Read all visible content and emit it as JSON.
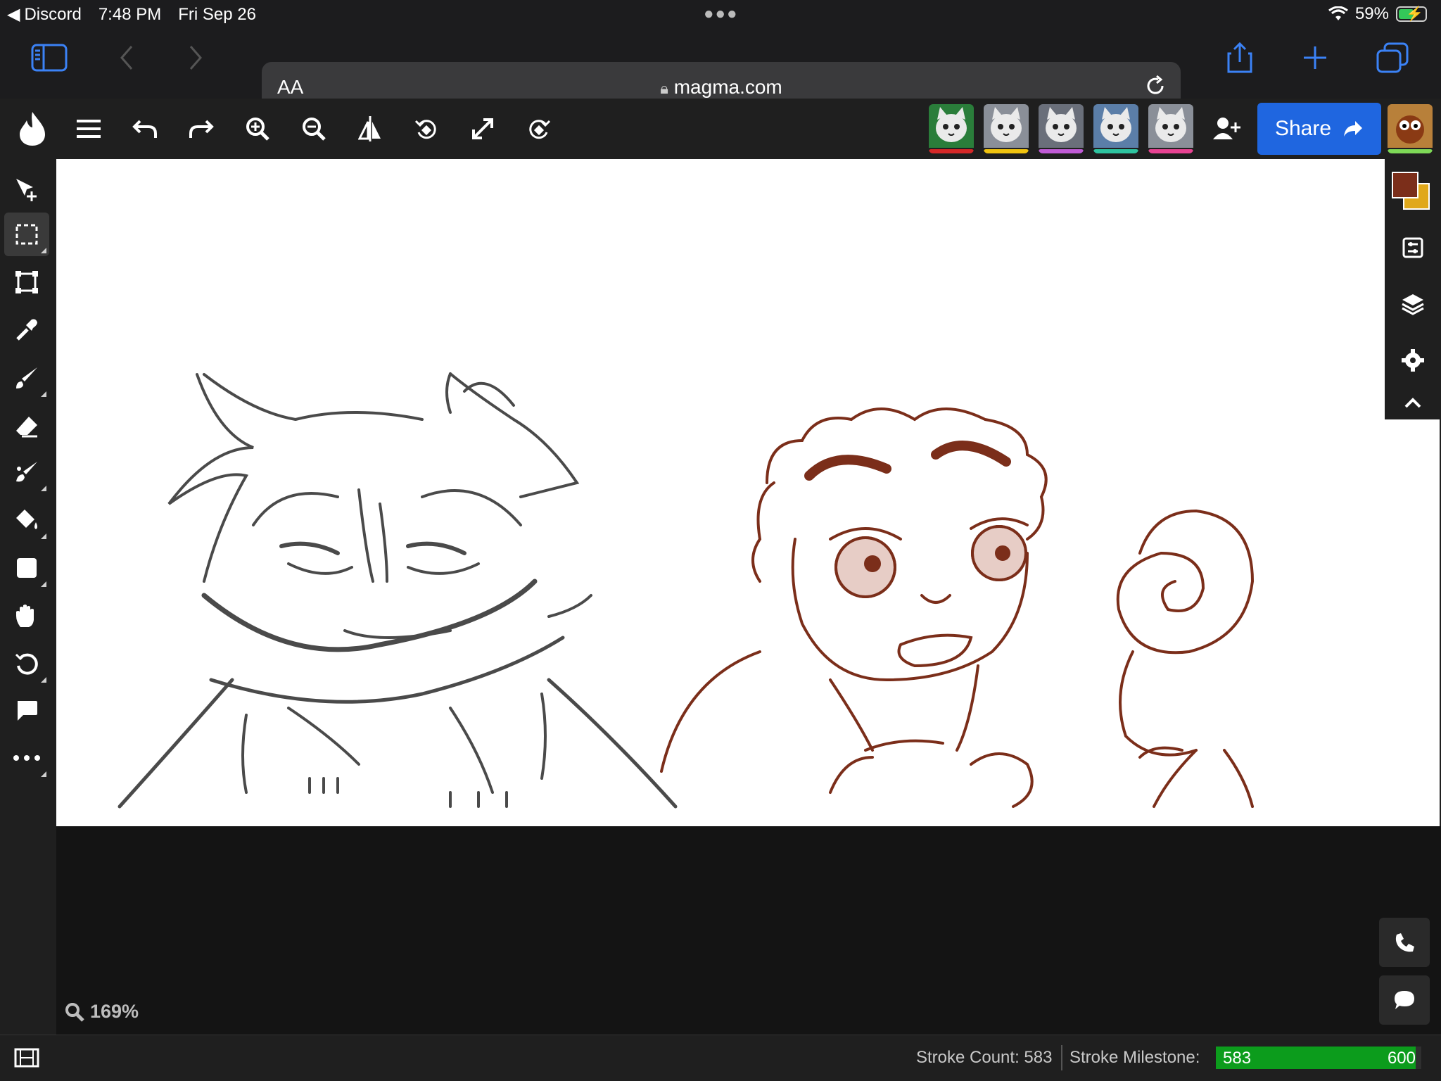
{
  "status_bar": {
    "back_app": "Discord",
    "time": "7:48 PM",
    "date": "Fri Sep 26",
    "battery": "59%",
    "battery_level": 0.59
  },
  "browser": {
    "text_size_label": "AA",
    "url": "magma.com"
  },
  "toolbar": {
    "share_label": "Share",
    "avatars": [
      {
        "name": "avatar-1",
        "strip_color": "#d62828",
        "bg": "#2a7d3a"
      },
      {
        "name": "avatar-2",
        "strip_color": "#f1c40f",
        "bg": "#8a8f98"
      },
      {
        "name": "avatar-3",
        "strip_color": "#c05bd6",
        "bg": "#6a6f7a"
      },
      {
        "name": "avatar-4",
        "strip_color": "#2ec4a0",
        "bg": "#5b7ea8"
      },
      {
        "name": "avatar-5",
        "strip_color": "#e84393",
        "bg": "#8a8f98"
      }
    ]
  },
  "colors": {
    "primary": "#7b2e1a",
    "secondary": "#e0a81a",
    "accent": "#1f66e0"
  },
  "zoom": {
    "label": "169%"
  },
  "stats": {
    "stroke_count_label": "Stroke Count: 583",
    "milestone_label": "Stroke Milestone:",
    "milestone_current": "583",
    "milestone_target": "600",
    "milestone_progress": 0.9717
  }
}
